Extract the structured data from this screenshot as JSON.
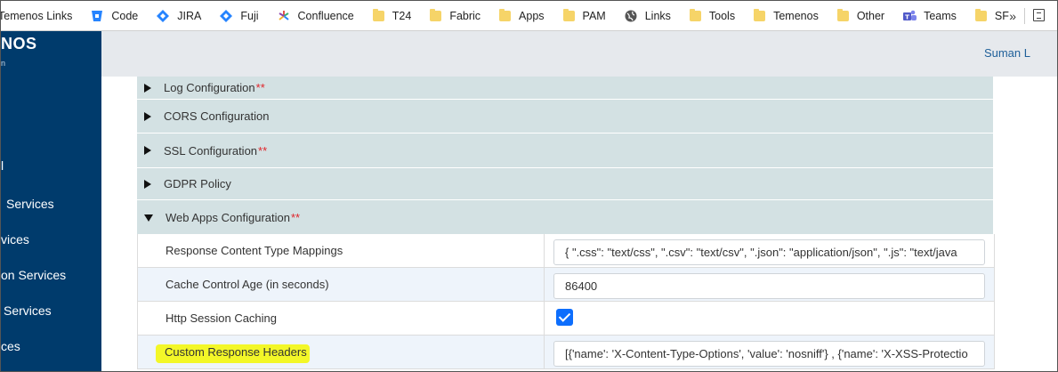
{
  "bookmarks": [
    {
      "label": "Temenos Links",
      "icon": "none"
    },
    {
      "label": "Code",
      "icon": "bitbucket-icon"
    },
    {
      "label": "JIRA",
      "icon": "jira-icon"
    },
    {
      "label": "Fuji",
      "icon": "jira-icon"
    },
    {
      "label": "Confluence",
      "icon": "confluence-icon"
    },
    {
      "label": "T24",
      "icon": "folder-icon"
    },
    {
      "label": "Fabric",
      "icon": "folder-icon"
    },
    {
      "label": "Apps",
      "icon": "folder-icon"
    },
    {
      "label": "PAM",
      "icon": "folder-icon"
    },
    {
      "label": "Links",
      "icon": "globe-icon"
    },
    {
      "label": "Tools",
      "icon": "folder-icon"
    },
    {
      "label": "Temenos",
      "icon": "folder-icon"
    },
    {
      "label": "Other",
      "icon": "folder-icon"
    },
    {
      "label": "Teams",
      "icon": "teams-icon"
    },
    {
      "label": "SF",
      "icon": "folder-icon"
    }
  ],
  "bookmarks_more": "»",
  "sidebar": {
    "logo": "NOS",
    "logo_sub": "n",
    "items": [
      "l",
      "Services",
      "vices",
      "on Services",
      "Services",
      "ces"
    ]
  },
  "header": {
    "user": "Suman L"
  },
  "sections": [
    {
      "title": "Log Configuration",
      "required": "**",
      "expanded": false
    },
    {
      "title": "CORS Configuration",
      "required": "",
      "expanded": false
    },
    {
      "title": "SSL Configuration",
      "required": "**",
      "expanded": false
    },
    {
      "title": "GDPR Policy",
      "required": "",
      "expanded": false
    },
    {
      "title": "Web Apps Configuration",
      "required": "**",
      "expanded": true
    }
  ],
  "web_apps_rows": [
    {
      "label": "Response Content Type Mappings",
      "value": "{ \".css\": \"text/css\", \".csv\": \"text/csv\", \".json\": \"application/json\", \".js\": \"text/java"
    },
    {
      "label": "Cache Control Age (in seconds)",
      "value": "86400"
    },
    {
      "label": "Http Session Caching",
      "checked": true
    },
    {
      "label": "Custom Response Headers",
      "value": "[{'name': 'X-Content-Type-Options', 'value': 'nosniff'} , {'name': 'X-XSS-Protectio"
    }
  ],
  "colors": {
    "sidebar": "#003b6c",
    "header": "#e6e9ed",
    "section": "#d3e1e3",
    "row_alt": "#eef4fb",
    "required": "#e0252b",
    "checkbox": "#0d6efd",
    "highlight": "#f3f728",
    "user_link": "#1e5f99"
  }
}
